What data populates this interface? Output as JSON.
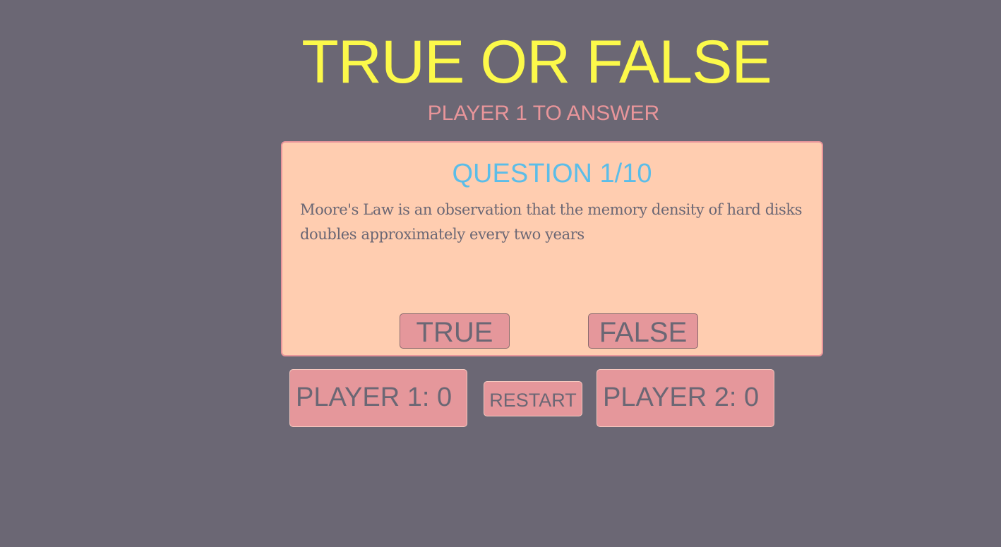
{
  "header": {
    "title": "TRUE OR FALSE",
    "turn_status": "PLAYER 1 TO ANSWER"
  },
  "question": {
    "counter": "QUESTION 1/10",
    "text": "Moore's Law is an observation that the memory density of hard disks doubles approximately every two years"
  },
  "answers": {
    "true_label": "TRUE",
    "false_label": "FALSE"
  },
  "scores": {
    "player1": "PLAYER 1: 0",
    "player2": "PLAYER 2: 0"
  },
  "controls": {
    "restart_label": "RESTART"
  },
  "colors": {
    "background": "#6b6774",
    "title": "#fcf94a",
    "turn_status": "#e8959a",
    "card": "#ffcdb0",
    "question_counter": "#5bbde8",
    "button": "#e5979b"
  }
}
